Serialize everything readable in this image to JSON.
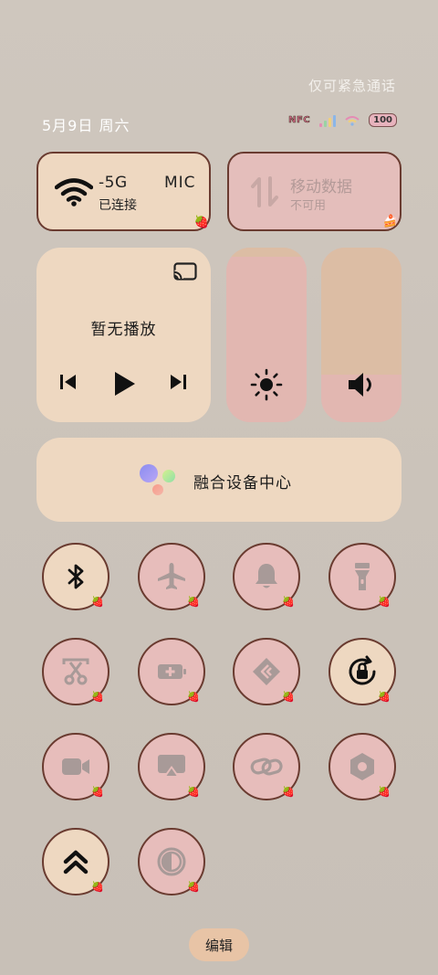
{
  "status": {
    "emergency_text": "仅可紧急通话",
    "date": "5月9日 周六",
    "nfc_label": "NFC",
    "battery": "100"
  },
  "wifi": {
    "name": "-5G",
    "name_suffix": "MIC",
    "status": "已连接",
    "icon": "wifi-icon"
  },
  "mobile_data": {
    "title": "移动数据",
    "status": "不可用",
    "icon": "mobile-data-icon"
  },
  "media": {
    "no_playback": "暂无播放",
    "icons": [
      "cast-icon",
      "previous-icon",
      "play-icon",
      "next-icon"
    ]
  },
  "sliders": {
    "brightness": {
      "icon": "brightness-icon",
      "level": 0.95
    },
    "volume": {
      "icon": "volume-icon",
      "level": 0.27
    }
  },
  "fusion": {
    "label": "融合设备中心"
  },
  "tiles": [
    {
      "name": "bluetooth",
      "state": "on"
    },
    {
      "name": "airplane-mode",
      "state": "off"
    },
    {
      "name": "ring-mode",
      "state": "off"
    },
    {
      "name": "flashlight",
      "state": "off"
    },
    {
      "name": "screenshot",
      "state": "off"
    },
    {
      "name": "battery-saver",
      "state": "off"
    },
    {
      "name": "share",
      "state": "off"
    },
    {
      "name": "rotation-lock",
      "state": "on"
    },
    {
      "name": "screen-record",
      "state": "off"
    },
    {
      "name": "screen-cast",
      "state": "off"
    },
    {
      "name": "link",
      "state": "off"
    },
    {
      "name": "settings-nut",
      "state": "off"
    },
    {
      "name": "performance-mode",
      "state": "on"
    },
    {
      "name": "dark-mode",
      "state": "off"
    }
  ],
  "edit_label": "编辑",
  "colors": {
    "card_on": "#eed8c1",
    "card_off": "#e4bebb",
    "border": "#6a3b30",
    "disabled_text": "#b39a98"
  }
}
